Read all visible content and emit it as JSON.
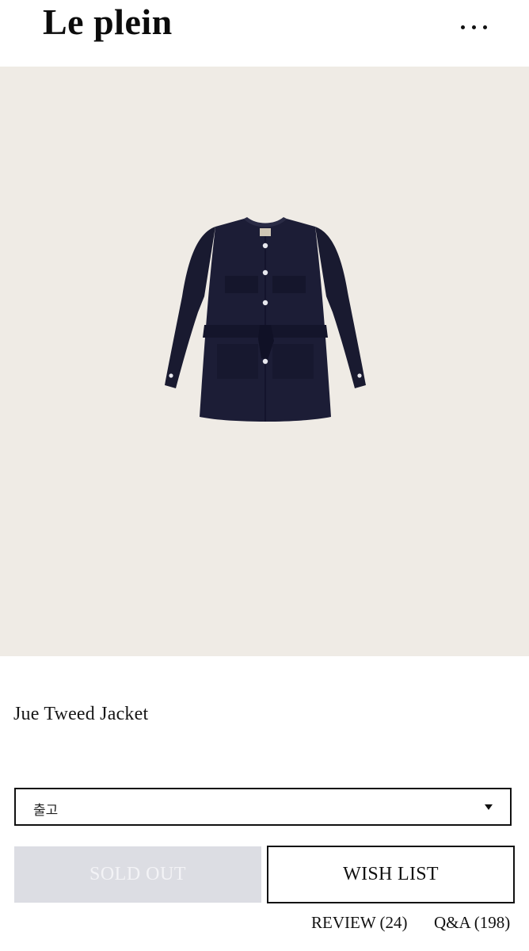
{
  "header": {
    "logo": "Le plein",
    "more_icon": "more-horizontal-icon"
  },
  "product": {
    "image_alt": "Jue Tweed Jacket",
    "name": "Jue Tweed Jacket"
  },
  "option_select": {
    "value": "출고"
  },
  "buttons": {
    "sold_out": "SOLD OUT",
    "wish_list": "WISH LIST"
  },
  "links": {
    "review": "REVIEW (24)",
    "qa": "Q&A (198)"
  },
  "colors": {
    "hero_bg": "#efebe5",
    "jacket": "#1a1b33",
    "sold_out_bg": "#dcdde3"
  }
}
